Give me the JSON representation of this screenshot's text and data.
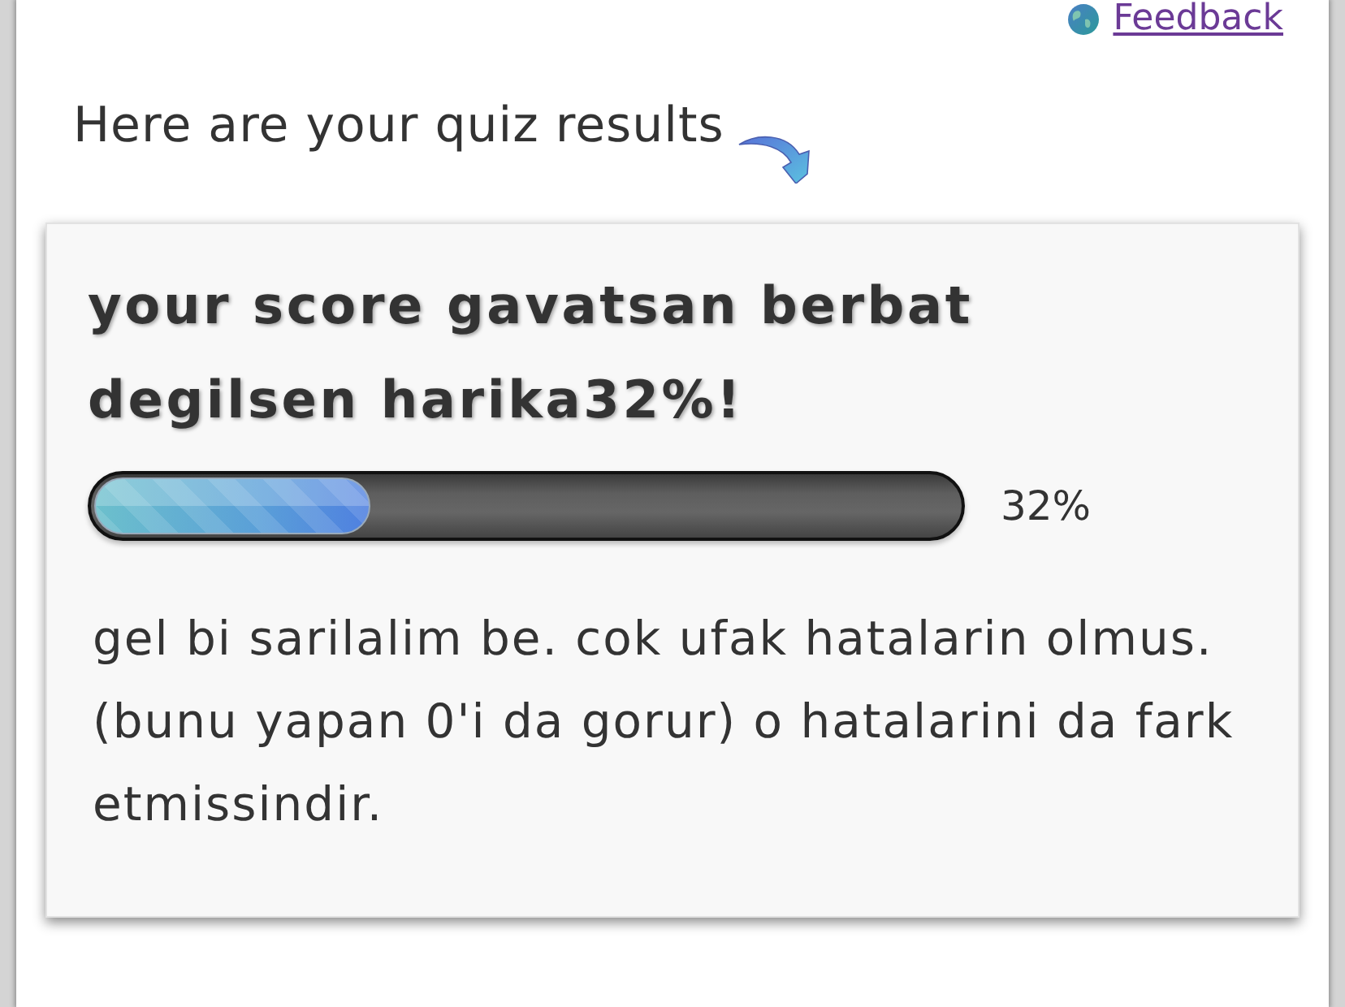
{
  "feedback_link": {
    "label": "Feedback"
  },
  "intro": {
    "text": "Here are your quiz results"
  },
  "result": {
    "title": "your score gavatsan berbat degilsen harika32%!",
    "progress": {
      "level": 0.32,
      "reading": "32%"
    },
    "description": "gel bi sarilalim be. cok ufak hatalarin olmus. (bunu yapan 0'i da gorur) o hatalarini da fark etmissindir."
  }
}
